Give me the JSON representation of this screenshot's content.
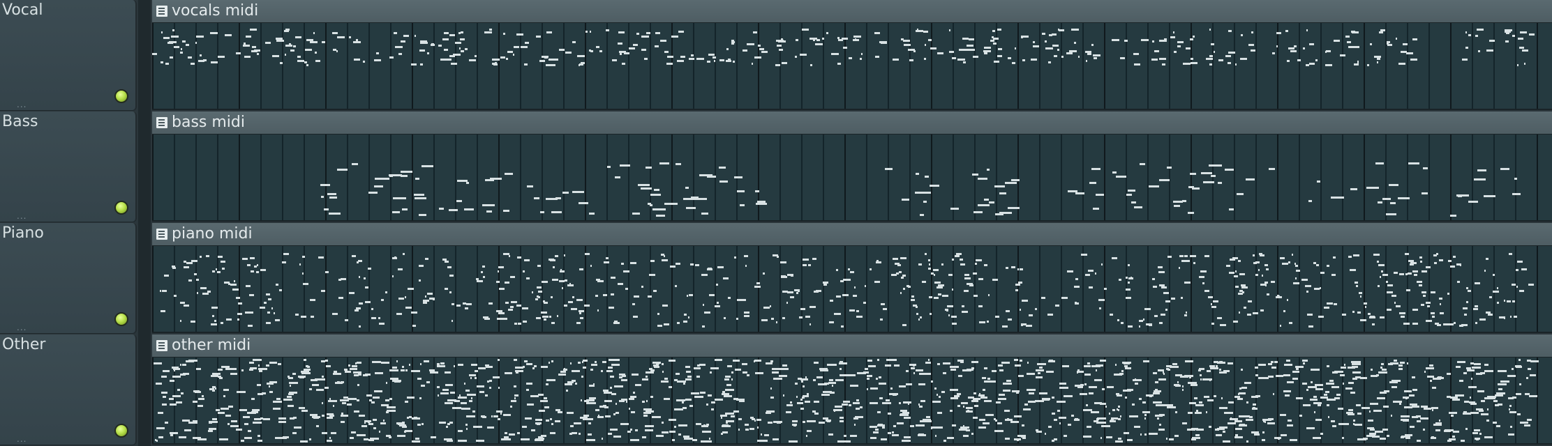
{
  "playlist": {
    "tracks": [
      {
        "name": "Vocal",
        "clip": "vocals midi",
        "seed": 11,
        "style": "vocal"
      },
      {
        "name": "Bass",
        "clip": "bass midi",
        "seed": 23,
        "style": "bass"
      },
      {
        "name": "Piano",
        "clip": "piano midi",
        "seed": 37,
        "style": "piano"
      },
      {
        "name": "Other",
        "clip": "other midi",
        "seed": 51,
        "style": "other"
      }
    ],
    "track_dots": "...",
    "colors": {
      "background": "#2b363b",
      "clip_body": "#253a40",
      "clip_title": "#56666c",
      "note": "#d9e2e4",
      "mute_led": "#b7e04a"
    }
  }
}
